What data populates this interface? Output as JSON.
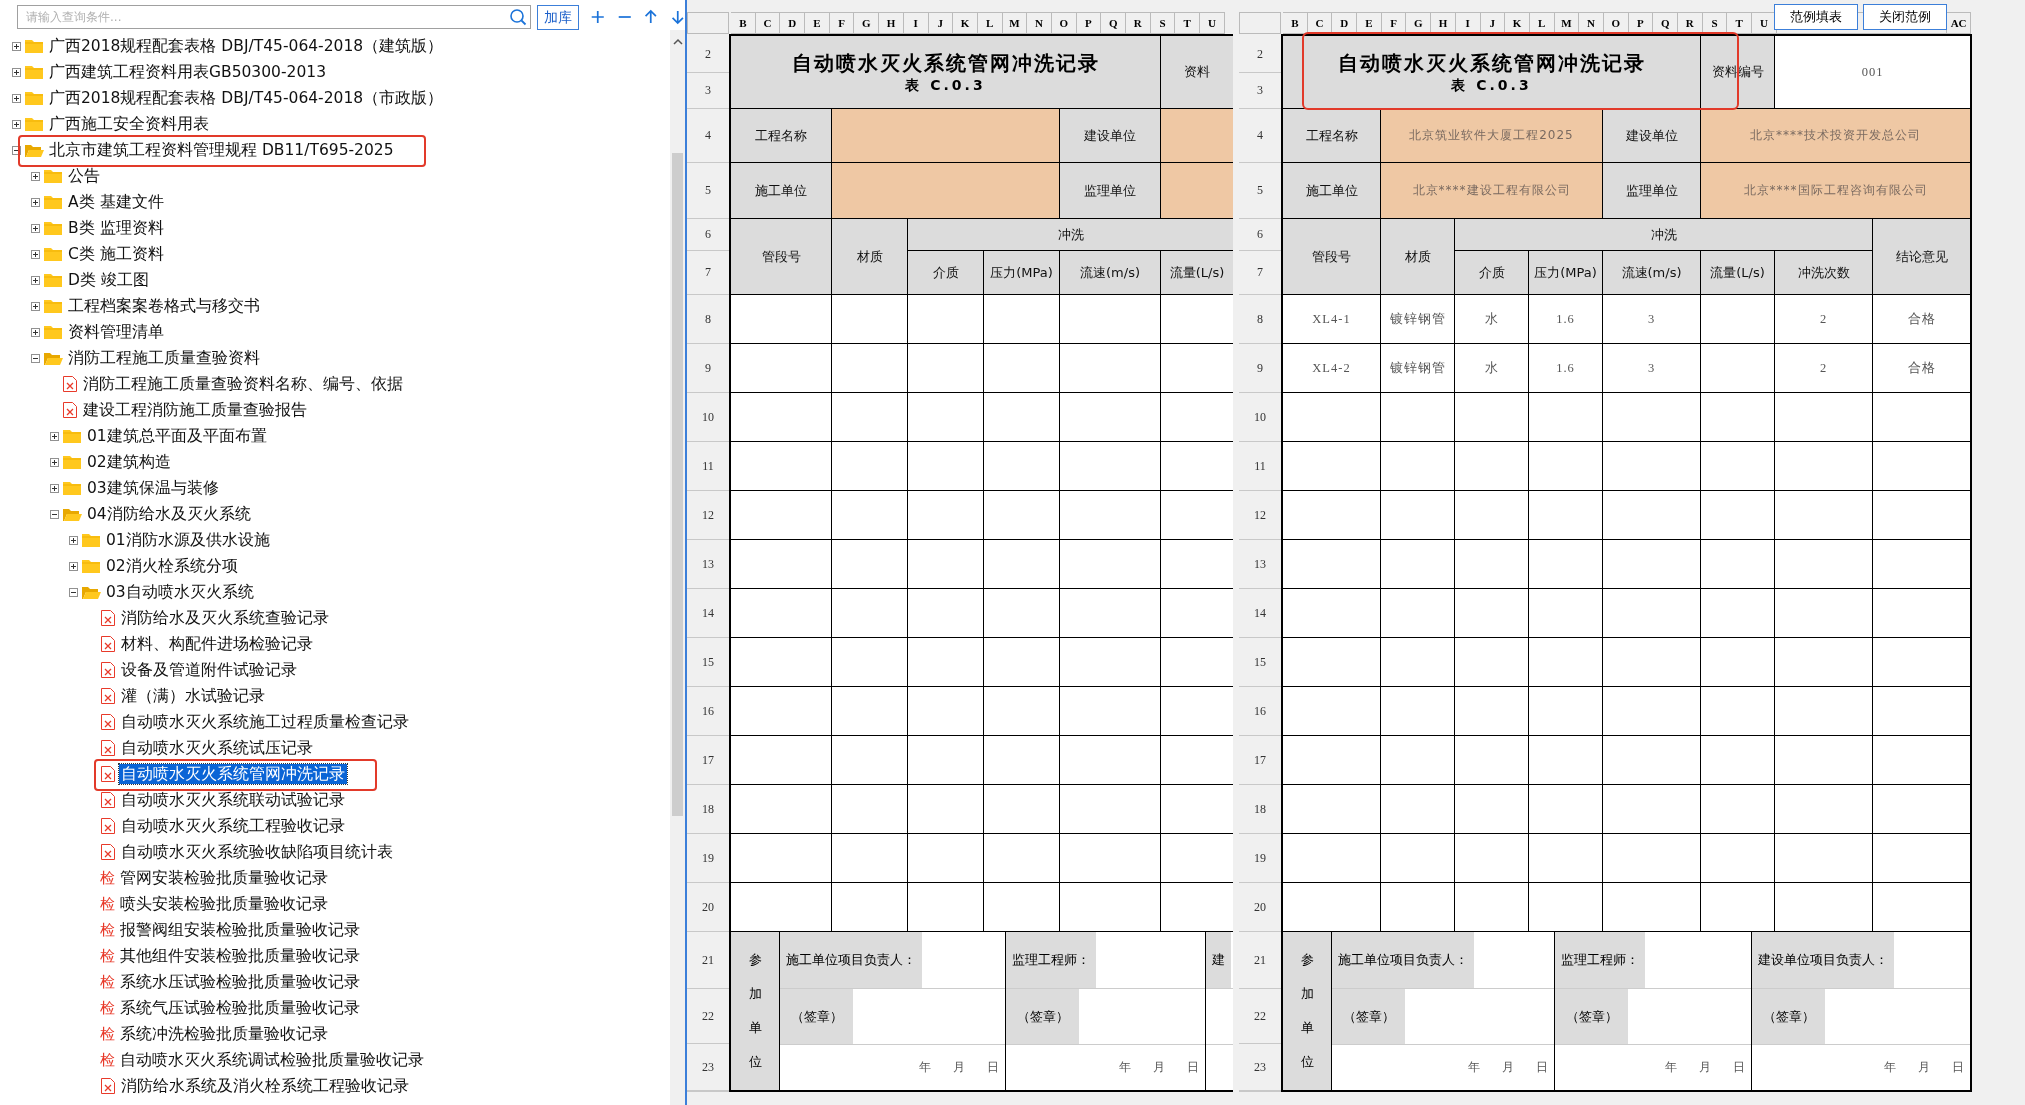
{
  "search": {
    "placeholder": "请输入查询条件...",
    "add_button": "加库"
  },
  "tree": [
    {
      "kind": "folder",
      "label": "广西2018规程配套表格 DBJ/T45-064-2018（建筑版）",
      "expanded": false,
      "selected": false,
      "marked": false
    },
    {
      "kind": "folder",
      "label": "广西建筑工程资料用表GB50300-2013",
      "expanded": false,
      "selected": false,
      "marked": false
    },
    {
      "kind": "folder",
      "label": "广西2018规程配套表格 DBJ/T45-064-2018（市政版）",
      "expanded": false,
      "selected": false,
      "marked": false
    },
    {
      "kind": "folder",
      "label": "广西施工安全资料用表",
      "expanded": false,
      "selected": false,
      "marked": false
    },
    {
      "kind": "folder",
      "label": "北京市建筑工程资料管理规程 DB11/T695-2025",
      "expanded": true,
      "selected": false,
      "marked": true,
      "children": [
        {
          "kind": "folder",
          "label": "公告",
          "expanded": false,
          "selected": false,
          "marked": false
        },
        {
          "kind": "folder",
          "label": "A类 基建文件",
          "expanded": false,
          "selected": false,
          "marked": false
        },
        {
          "kind": "folder",
          "label": "B类 监理资料",
          "expanded": false,
          "selected": false,
          "marked": false
        },
        {
          "kind": "folder",
          "label": "C类 施工资料",
          "expanded": false,
          "selected": false,
          "marked": false
        },
        {
          "kind": "folder",
          "label": "D类 竣工图",
          "expanded": false,
          "selected": false,
          "marked": false
        },
        {
          "kind": "folder",
          "label": "工程档案案卷格式与移交书",
          "expanded": false,
          "selected": false,
          "marked": false
        },
        {
          "kind": "folder",
          "label": "资料管理清单",
          "expanded": false,
          "selected": false,
          "marked": false
        },
        {
          "kind": "folder",
          "label": "消防工程施工质量查验资料",
          "expanded": true,
          "selected": false,
          "marked": false,
          "children": [
            {
              "kind": "sheet",
              "label": "消防工程施工质量查验资料名称、编号、依据",
              "selected": false,
              "marked": false
            },
            {
              "kind": "sheet",
              "label": "建设工程消防施工质量查验报告",
              "selected": false,
              "marked": false
            },
            {
              "kind": "folder",
              "label": "01建筑总平面及平面布置",
              "expanded": false,
              "selected": false,
              "marked": false
            },
            {
              "kind": "folder",
              "label": "02建筑构造",
              "expanded": false,
              "selected": false,
              "marked": false
            },
            {
              "kind": "folder",
              "label": "03建筑保温与装修",
              "expanded": false,
              "selected": false,
              "marked": false
            },
            {
              "kind": "folder",
              "label": "04消防给水及灭火系统",
              "expanded": true,
              "selected": false,
              "marked": false,
              "children": [
                {
                  "kind": "folder",
                  "label": "01消防水源及供水设施",
                  "expanded": false,
                  "selected": false,
                  "marked": false
                },
                {
                  "kind": "folder",
                  "label": "02消火栓系统分项",
                  "expanded": false,
                  "selected": false,
                  "marked": false
                },
                {
                  "kind": "folder",
                  "label": "03自动喷水灭火系统",
                  "expanded": true,
                  "selected": false,
                  "marked": false,
                  "children": [
                    {
                      "kind": "sheet",
                      "label": "消防给水及灭火系统查验记录",
                      "selected": false,
                      "marked": false
                    },
                    {
                      "kind": "sheet",
                      "label": "材料、构配件进场检验记录",
                      "selected": false,
                      "marked": false
                    },
                    {
                      "kind": "sheet",
                      "label": "设备及管道附件试验记录",
                      "selected": false,
                      "marked": false
                    },
                    {
                      "kind": "sheet",
                      "label": "灌（满）水试验记录",
                      "selected": false,
                      "marked": false
                    },
                    {
                      "kind": "sheet",
                      "label": "自动喷水灭火系统施工过程质量检查记录",
                      "selected": false,
                      "marked": false
                    },
                    {
                      "kind": "sheet",
                      "label": "自动喷水灭火系统试压记录",
                      "selected": false,
                      "marked": false
                    },
                    {
                      "kind": "sheet",
                      "label": "自动喷水灭火系统管网冲洗记录",
                      "selected": true,
                      "marked": true
                    },
                    {
                      "kind": "sheet",
                      "label": "自动喷水灭火系统联动试验记录",
                      "selected": false,
                      "marked": false
                    },
                    {
                      "kind": "sheet",
                      "label": "自动喷水灭火系统工程验收记录",
                      "selected": false,
                      "marked": false
                    },
                    {
                      "kind": "sheet",
                      "label": "自动喷水灭火系统验收缺陷项目统计表",
                      "selected": false,
                      "marked": false
                    },
                    {
                      "kind": "check",
                      "badge": "检",
                      "label": "管网安装检验批质量验收记录",
                      "selected": false,
                      "marked": false
                    },
                    {
                      "kind": "check",
                      "badge": "检",
                      "label": "喷头安装检验批质量验收记录",
                      "selected": false,
                      "marked": false
                    },
                    {
                      "kind": "check",
                      "badge": "检",
                      "label": "报警阀组安装检验批质量验收记录",
                      "selected": false,
                      "marked": false
                    },
                    {
                      "kind": "check",
                      "badge": "检",
                      "label": "其他组件安装检验批质量验收记录",
                      "selected": false,
                      "marked": false
                    },
                    {
                      "kind": "check",
                      "badge": "检",
                      "label": "系统水压试验检验批质量验收记录",
                      "selected": false,
                      "marked": false
                    },
                    {
                      "kind": "check",
                      "badge": "检",
                      "label": "系统气压试验检验批质量验收记录",
                      "selected": false,
                      "marked": false
                    },
                    {
                      "kind": "check",
                      "badge": "检",
                      "label": "系统冲洗检验批质量验收记录",
                      "selected": false,
                      "marked": false
                    },
                    {
                      "kind": "check",
                      "badge": "检",
                      "label": "自动喷水灭火系统调试检验批质量验收记录",
                      "selected": false,
                      "marked": false
                    },
                    {
                      "kind": "sheet",
                      "label": "消防给水系统及消火栓系统工程验收记录",
                      "selected": false,
                      "marked": false
                    }
                  ]
                }
              ]
            }
          ]
        }
      ]
    }
  ],
  "sheets": [
    {
      "column_headers": [
        "B",
        "C",
        "D",
        "E",
        "F",
        "G",
        "H",
        "I",
        "J",
        "K",
        "L",
        "M",
        "N",
        "O",
        "P",
        "Q",
        "R",
        "S",
        "T",
        "U"
      ],
      "row_numbers": [
        "2",
        "3",
        "4",
        "5",
        "6",
        "7",
        "8",
        "9",
        "10",
        "11",
        "12",
        "13",
        "14",
        "15",
        "16",
        "17",
        "18",
        "19",
        "20",
        "21",
        "22",
        "23"
      ],
      "title": "自动喷水灭火系统管网冲洗记录",
      "subtitle": "表 C.0.3",
      "title_marked": false,
      "record_no_label": "资料",
      "project_name_label": "工程名称",
      "builder_label": "建设单位",
      "contractor_label": "施工单位",
      "supervisor_label": "监理单位",
      "pipe_label": "管段号",
      "material_label": "材质",
      "flush_label": "冲洗",
      "flush_columns": [
        "介质",
        "压力(MPa)",
        "流速(m/s)",
        "流量(L/s)"
      ],
      "participants_label": "参加单位",
      "signatures": [
        {
          "role": "施工单位项目负责人：",
          "seal": "（签章）",
          "date": [
            "年",
            "月",
            "日"
          ]
        },
        {
          "role": "监理工程师：",
          "seal": "（签章）",
          "date": [
            "年",
            "月",
            "日"
          ]
        },
        {
          "role": "建"
        }
      ]
    },
    {
      "column_headers": [
        "B",
        "C",
        "D",
        "E",
        "F",
        "G",
        "H",
        "I",
        "J",
        "K",
        "L",
        "M",
        "N",
        "O",
        "P",
        "Q",
        "R",
        "S",
        "T",
        "U"
      ],
      "trailing_column_headers": [
        "AC"
      ],
      "buttons": [
        "范例填表",
        "关闭范例"
      ],
      "row_numbers": [
        "2",
        "3",
        "4",
        "5",
        "6",
        "7",
        "8",
        "9",
        "10",
        "11",
        "12",
        "13",
        "14",
        "15",
        "16",
        "17",
        "18",
        "19",
        "20",
        "21",
        "22",
        "23"
      ],
      "title": "自动喷水灭火系统管网冲洗记录",
      "subtitle": "表 C.0.3",
      "title_marked": true,
      "record_no_label": "资料编号",
      "record_no": "001",
      "project_name_label": "工程名称",
      "project_name": "北京筑业软件大厦工程2025",
      "builder_label": "建设单位",
      "builder": "北京****技术投资开发总公司",
      "contractor_label": "施工单位",
      "contractor": "北京****建设工程有限公司",
      "supervisor_label": "监理单位",
      "supervisor": "北京****国际工程咨询有限公司",
      "pipe_label": "管段号",
      "material_label": "材质",
      "flush_label": "冲洗",
      "flush_columns": [
        "介质",
        "压力(MPa)",
        "流速(m/s)",
        "流量(L/s)",
        "冲洗次数"
      ],
      "conclusion_label": "结论意见",
      "rows": [
        {
          "pipe": "XL4-1",
          "material": "镀锌钢管",
          "medium": "水",
          "pressure": "1.6",
          "velocity": "3",
          "count": "2",
          "conclusion": "合格"
        },
        {
          "pipe": "XL4-2",
          "material": "镀锌钢管",
          "medium": "水",
          "pressure": "1.6",
          "velocity": "3",
          "count": "2",
          "conclusion": "合格"
        }
      ],
      "participants_label": "参加单位",
      "signatures": [
        {
          "role": "施工单位项目负责人：",
          "seal": "（签章）",
          "date": [
            "年",
            "月",
            "日"
          ]
        },
        {
          "role": "监理工程师：",
          "seal": "（签章）",
          "date": [
            "年",
            "月",
            "日"
          ]
        },
        {
          "role": "建设单位项目负责人：",
          "seal": "（签章）",
          "date": [
            "年",
            "月",
            "日"
          ]
        }
      ]
    }
  ]
}
